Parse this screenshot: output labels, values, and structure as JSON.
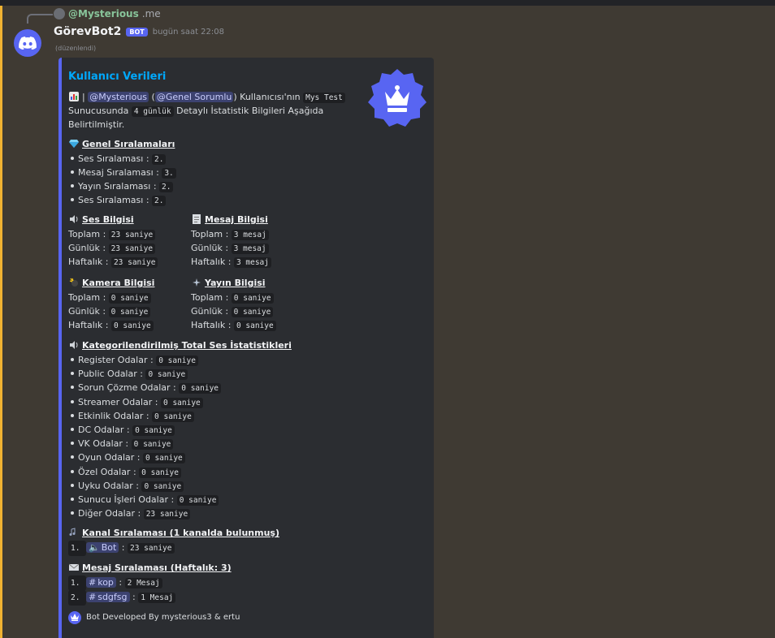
{
  "reply": {
    "name": "@Mysterious",
    "text": ".me"
  },
  "author": {
    "name": "GörevBot2",
    "tag": "BOT",
    "timestamp": "bugün saat 22:08",
    "edited": "(düzenlendi)"
  },
  "embed": {
    "title": "Kullanıcı Verileri",
    "intro": {
      "icon": "bar-chart-icon",
      "mention_user": "@Mysterious",
      "mention_role": "@Genel Sorumlu",
      "text_after_role": ") Kullanıcısı'nın",
      "server_name": "Mys Test",
      "line2_a": "Sunucusunda",
      "days": "4 günlük",
      "line2_b": "Detaylı İstatistik Bilgileri Aşağıda",
      "line3": "Belirtilmiştir."
    },
    "general_rankings": {
      "heading": "Genel Sıralamaları",
      "items": [
        {
          "label": "Ses Sıralaması :",
          "value": "2."
        },
        {
          "label": "Mesaj Sıralaması :",
          "value": "3."
        },
        {
          "label": "Yayın Sıralaması :",
          "value": "2."
        },
        {
          "label": "Ses Sıralaması :",
          "value": "2."
        }
      ]
    },
    "voice_info": {
      "heading": "Ses Bilgisi",
      "rows": [
        {
          "label": "Toplam :",
          "value": "23 saniye"
        },
        {
          "label": "Günlük :",
          "value": "23 saniye"
        },
        {
          "label": "Haftalık :",
          "value": "23 saniye"
        }
      ]
    },
    "message_info": {
      "heading": "Mesaj Bilgisi",
      "rows": [
        {
          "label": "Toplam :",
          "value": "3 mesaj"
        },
        {
          "label": "Günlük :",
          "value": "3 mesaj"
        },
        {
          "label": "Haftalık :",
          "value": "3 mesaj"
        }
      ]
    },
    "camera_info": {
      "heading": "Kamera Bilgisi",
      "rows": [
        {
          "label": "Toplam :",
          "value": "0 saniye"
        },
        {
          "label": "Günlük :",
          "value": "0 saniye"
        },
        {
          "label": "Haftalık :",
          "value": "0 saniye"
        }
      ]
    },
    "stream_info": {
      "heading": "Yayın Bilgisi",
      "rows": [
        {
          "label": "Toplam :",
          "value": "0 saniye"
        },
        {
          "label": "Günlük :",
          "value": "0 saniye"
        },
        {
          "label": "Haftalık :",
          "value": "0 saniye"
        }
      ]
    },
    "categorized": {
      "heading": "Kategorilendirilmiş Total Ses İstatistikleri",
      "items": [
        {
          "label": "Register Odalar :",
          "value": "0 saniye"
        },
        {
          "label": "Public Odalar :",
          "value": "0 saniye"
        },
        {
          "label": "Sorun Çözme Odalar :",
          "value": "0 saniye"
        },
        {
          "label": "Streamer Odalar :",
          "value": "0 saniye"
        },
        {
          "label": "Etkinlik Odalar :",
          "value": "0 saniye"
        },
        {
          "label": "DC Odalar :",
          "value": "0 saniye"
        },
        {
          "label": "VK Odalar :",
          "value": "0 saniye"
        },
        {
          "label": "Oyun Odalar :",
          "value": "0 saniye"
        },
        {
          "label": "Özel Odalar :",
          "value": "0 saniye"
        },
        {
          "label": "Uyku Odalar :",
          "value": "0 saniye"
        },
        {
          "label": "Sunucu İşleri Odalar :",
          "value": "0 saniye"
        },
        {
          "label": "Diğer Odalar :",
          "value": "23 saniye"
        }
      ]
    },
    "channel_ranking": {
      "heading": "Kanal Sıralaması (1 kanalda bulunmuş)",
      "items": [
        {
          "ord": "1.",
          "channel": "Bot",
          "sep": ":",
          "value": "23 saniye"
        }
      ]
    },
    "message_ranking": {
      "heading": "Mesaj Sıralaması (Haftalık: 3)",
      "items": [
        {
          "ord": "1.",
          "channel": "kop",
          "sep": ":",
          "value": "2 Mesaj"
        },
        {
          "ord": "2.",
          "channel": "sdgfsg",
          "sep": ":",
          "value": "1 Mesaj"
        }
      ]
    },
    "footer": "Bot Developed By mysterious3 & ertu"
  },
  "colors": {
    "accent": "#5865f2",
    "title": "#00a8fc",
    "mention_bg": "#3c4270",
    "highlight": "#f0b232"
  }
}
